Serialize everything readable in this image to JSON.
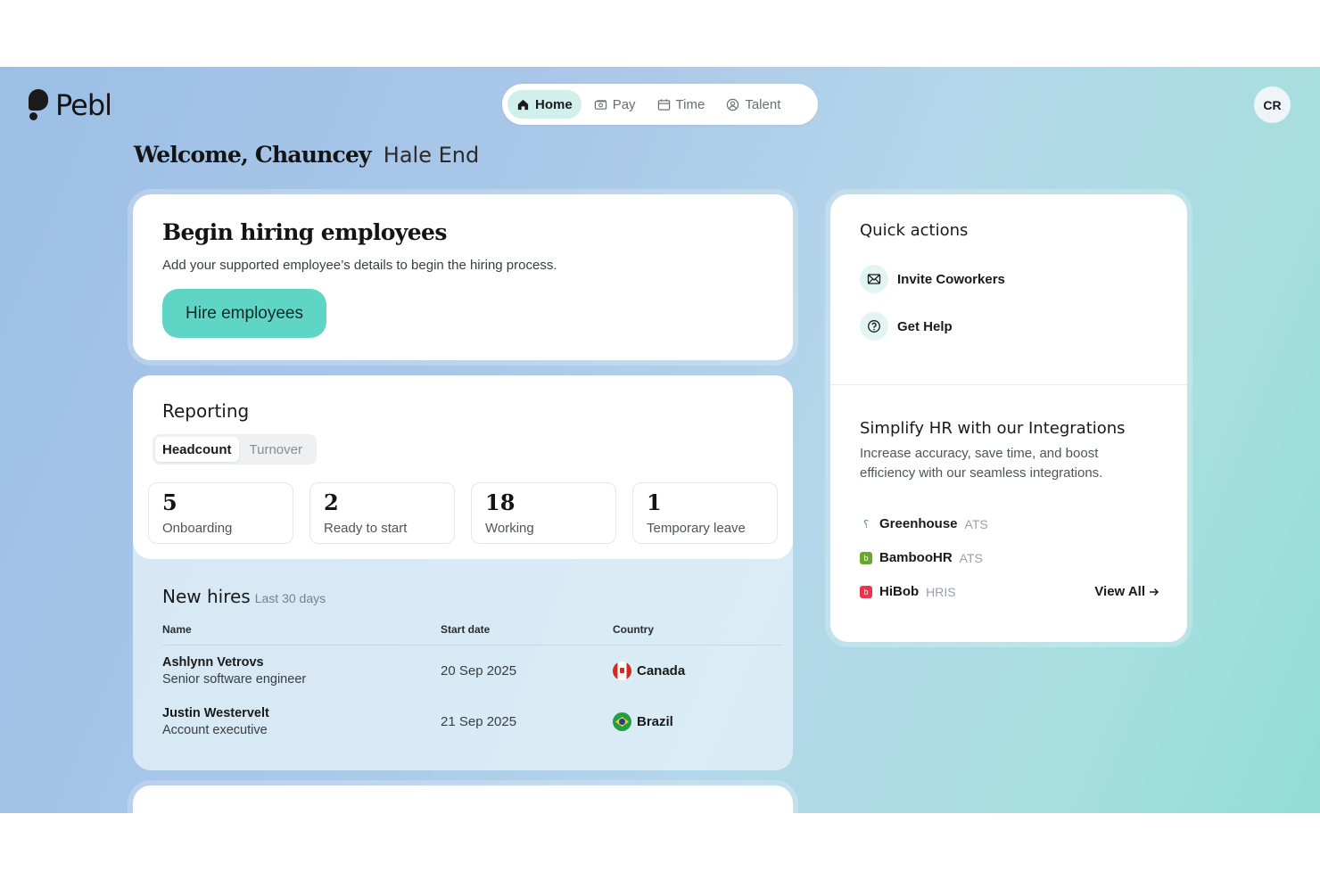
{
  "brand": {
    "name": "Pebl"
  },
  "nav": {
    "tabs": [
      {
        "label": "Home",
        "icon": "home-icon",
        "active": true
      },
      {
        "label": "Pay",
        "icon": "money-icon",
        "active": false
      },
      {
        "label": "Time",
        "icon": "calendar-icon",
        "active": false
      },
      {
        "label": "Talent",
        "icon": "person-icon",
        "active": false
      }
    ]
  },
  "user": {
    "initials": "CR"
  },
  "welcome": {
    "greeting": "Welcome, Chauncey",
    "company": "Hale End"
  },
  "hire_card": {
    "title": "Begin hiring employees",
    "description": "Add your supported employee’s details to begin the hiring process.",
    "button_label": "Hire employees"
  },
  "reporting": {
    "title": "Reporting",
    "tabs": [
      {
        "label": "Headcount",
        "active": true
      },
      {
        "label": "Turnover",
        "active": false
      }
    ],
    "stats": [
      {
        "value": "5",
        "label": "Onboarding"
      },
      {
        "value": "2",
        "label": "Ready to start"
      },
      {
        "value": "18",
        "label": "Working"
      },
      {
        "value": "1",
        "label": "Temporary leave"
      }
    ]
  },
  "new_hires": {
    "title": "New hires",
    "subtitle": "Last 30 days",
    "columns": [
      "Name",
      "Start date",
      "Country"
    ],
    "rows": [
      {
        "name": "Ashlynn Vetrovs",
        "role": "Senior software engineer",
        "start_date": "20 Sep 2025",
        "country": "Canada"
      },
      {
        "name": "Justin Westervelt",
        "role": "Account executive",
        "start_date": "21 Sep 2025",
        "country": "Brazil"
      }
    ]
  },
  "quick_actions": {
    "title": "Quick actions",
    "items": [
      {
        "label": "Invite Coworkers",
        "icon": "envelope-icon"
      },
      {
        "label": "Get Help",
        "icon": "help-circle-icon"
      }
    ]
  },
  "integrations": {
    "title": "Simplify HR with our Integrations",
    "description": "Increase accuracy, save time, and boost efficiency with our seamless integrations.",
    "items": [
      {
        "name": "Greenhouse",
        "type": "ATS",
        "logo": "greenhouse-logo",
        "color": "#3b9c80"
      },
      {
        "name": "BambooHR",
        "type": "ATS",
        "logo": "bamboohr-logo",
        "color": "#6aa72f"
      },
      {
        "name": "HiBob",
        "type": "HRIS",
        "logo": "hibob-logo",
        "color": "#e8344e"
      }
    ],
    "view_all_label": "View All"
  },
  "colors": {
    "accent": "#5fd5c6",
    "accent_soft": "#d1f0ec"
  }
}
